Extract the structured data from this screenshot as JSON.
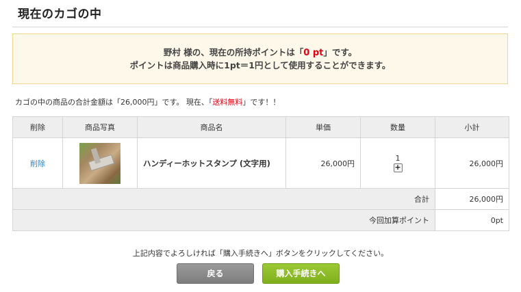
{
  "page_title": "現在のカゴの中",
  "points_notice": {
    "user_name": "野村",
    "honorific": "様の、現在の所持ポイントは「",
    "points_value": "0 pt",
    "line1_suffix": "」です。",
    "line2": "ポイントは商品購入時に1pt＝1円として使用することができます。"
  },
  "summary": {
    "prefix": "カゴの中の商品の合計金額は「26,000円」です。 現在、「",
    "shipping": "送料無料",
    "suffix": "」です！！"
  },
  "table": {
    "headers": {
      "delete": "削除",
      "photo": "商品写真",
      "name": "商品名",
      "price": "単価",
      "quantity": "数量",
      "subtotal": "小計"
    },
    "items": [
      {
        "delete_label": "削除",
        "name": "ハンディーホットスタンプ (文字用)",
        "price": "26,000円",
        "quantity": "1",
        "subtotal": "26,000円"
      }
    ],
    "total_label": "合計",
    "total_value": "26,000円",
    "points_label": "今回加算ポイント",
    "points_value": "0pt"
  },
  "instruction": "上記内容でよろしければ「購入手続きへ」ボタンをクリックしてください。",
  "buttons": {
    "back": "戻る",
    "checkout": "購入手続きへ"
  },
  "colors": {
    "accent_red": "#e60012",
    "link_blue": "#2a86c9",
    "checkout_green": "#8dbd26",
    "back_gray": "#8a8a8a",
    "notice_bg": "#fdf8e9"
  }
}
